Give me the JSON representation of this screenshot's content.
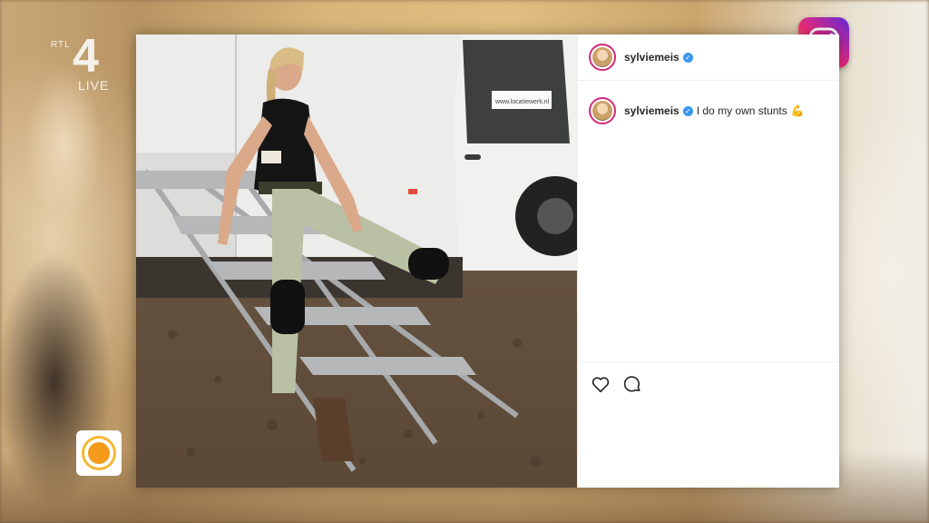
{
  "broadcast": {
    "channel_prefix": "RTL",
    "channel_number": "4",
    "live_label": "LIVE"
  },
  "post": {
    "username": "sylviemeis",
    "verified": true,
    "caption": "I do my own stunts",
    "caption_emoji": "💪",
    "van_text": "www.locatiewerk.nl"
  },
  "icons": {
    "instagram": "instagram-logo",
    "like": "heart-icon",
    "comment": "comment-bubble-icon",
    "verified": "verified-badge-icon",
    "morning_show": "sun-logo"
  },
  "colors": {
    "accent_blue": "#3897f0",
    "story_ring": "#d62976"
  }
}
